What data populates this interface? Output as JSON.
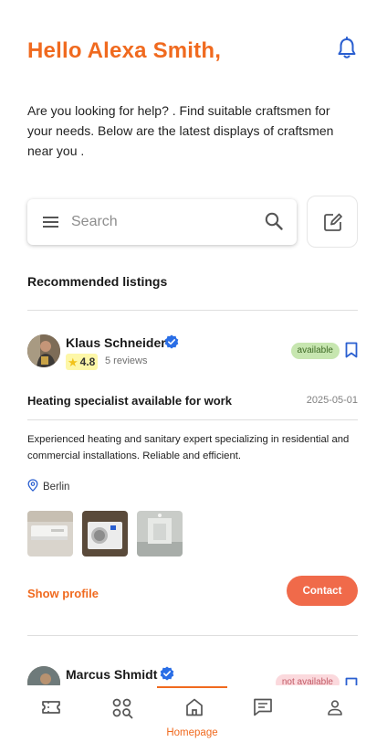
{
  "header": {
    "greeting": "Hello Alexa Smith,"
  },
  "intro": "Are you looking for help? . Find suitable craftsmen for your needs. Below are the latest displays of craftsmen near you .",
  "search": {
    "placeholder": "Search",
    "value": ""
  },
  "section_title": "Recommended listings",
  "listings": [
    {
      "name": "Klaus Schneider",
      "rating": "4.8",
      "reviews": "5 reviews",
      "status": "available",
      "title": "Heating specialist available for work",
      "date": "2025-05-01",
      "description": "Experienced heating and sanitary expert specializing in residential and commercial installations. Reliable and efficient.",
      "location": "Berlin",
      "show_profile": "Show profile",
      "contact": "Contact"
    },
    {
      "name": "Marcus Shmidt",
      "status": "not available"
    }
  ],
  "nav": {
    "active_label": "Homepage"
  },
  "colors": {
    "accent": "#f06a1f",
    "contact": "#f06a4a",
    "verified": "#2a6ee6",
    "icon_blue": "#2a5fd0"
  },
  "icons": [
    "menu-icon",
    "search-icon",
    "edit-icon",
    "bell-icon",
    "verified-badge-icon",
    "star-icon",
    "bookmark-icon",
    "location-icon",
    "ticket-icon",
    "categories-search-icon",
    "home-icon",
    "chat-icon",
    "person-icon"
  ]
}
